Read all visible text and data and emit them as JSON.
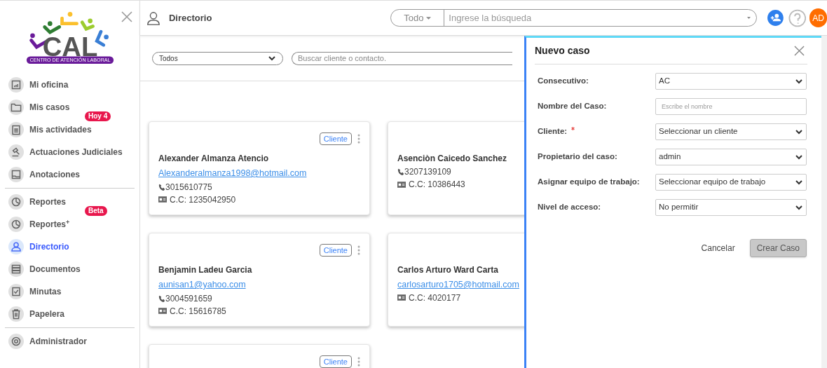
{
  "logo": {
    "title": "CAL",
    "subtitle": "CENTRO DE ATENCIÓN LABORAL"
  },
  "sidebar": {
    "groups": [
      {
        "items": [
          {
            "label": "Mi oficina",
            "selected": false
          },
          {
            "label": "Mis casos",
            "selected": false
          },
          {
            "label": "Mis actividades",
            "selected": false,
            "badge": "Hoy 4"
          },
          {
            "label": "Actuaciones Judiciales",
            "selected": false
          },
          {
            "label": "Anotaciones",
            "selected": false
          }
        ]
      },
      {
        "items": [
          {
            "label": "Reportes",
            "selected": false
          },
          {
            "label": "Reportes$^{+}$",
            "selected": false,
            "badge": "Beta"
          },
          {
            "label": "Directorio",
            "selected": true
          },
          {
            "label": "Documentos",
            "selected": false
          },
          {
            "label": "Minutas",
            "selected": false
          },
          {
            "label": "Papelera",
            "selected": false
          }
        ]
      },
      {
        "items": [
          {
            "label": "Administrador",
            "selected": false
          }
        ]
      }
    ]
  },
  "header": {
    "title": "Directorio",
    "search_scope": "Todo",
    "search_placeholder": "Ingrese la búsqueda",
    "avatar": "AD"
  },
  "filters": {
    "type": "Todos",
    "search_placeholder": "Buscar cliente o contacto."
  },
  "contacts": [
    {
      "name": "Alexander Almanza Atencio",
      "email": "Alexanderalmanza1998@hotmail.com",
      "phone": "3015610775",
      "id": "C.C: 1235042950",
      "badge": "Cliente"
    },
    {
      "name": "Asenciòn Caicedo Sanchez",
      "phone": "3207139109",
      "id": "C.C: 10386443"
    },
    {
      "name": "Benjamin Ladeu Garcia",
      "email": "aunisan1@yahoo.com",
      "phone": "3004591659",
      "id": "C.C: 15616785",
      "badge": "Cliente"
    },
    {
      "name": "Carlos Arturo Ward Carta",
      "email": "carlosarturo1705@hotmail.com",
      "id": "C.C: 4020177"
    },
    {
      "badge": "Cliente"
    }
  ],
  "panel": {
    "title": "Nuevo caso",
    "fields": [
      {
        "label": "Consecutivo:",
        "kind": "select",
        "value": "AC",
        "required": false
      },
      {
        "label": "Nombre del Caso:",
        "kind": "text",
        "placeholder": "Escribe el nombre",
        "required": false
      },
      {
        "label": "Cliente:",
        "kind": "select",
        "value": "Seleccionar un cliente",
        "required": true
      },
      {
        "label": "Propietario del caso:",
        "kind": "select",
        "value": "admin",
        "required": false
      },
      {
        "label": "Asignar equipo de trabajo:",
        "kind": "select",
        "value": "Seleccionar equipo de trabajo",
        "required": false
      },
      {
        "label": "Nivel de acceso:",
        "kind": "select",
        "value": "No permitir",
        "required": false
      }
    ],
    "cancel": "Cancelar",
    "submit": "Crear Caso"
  }
}
